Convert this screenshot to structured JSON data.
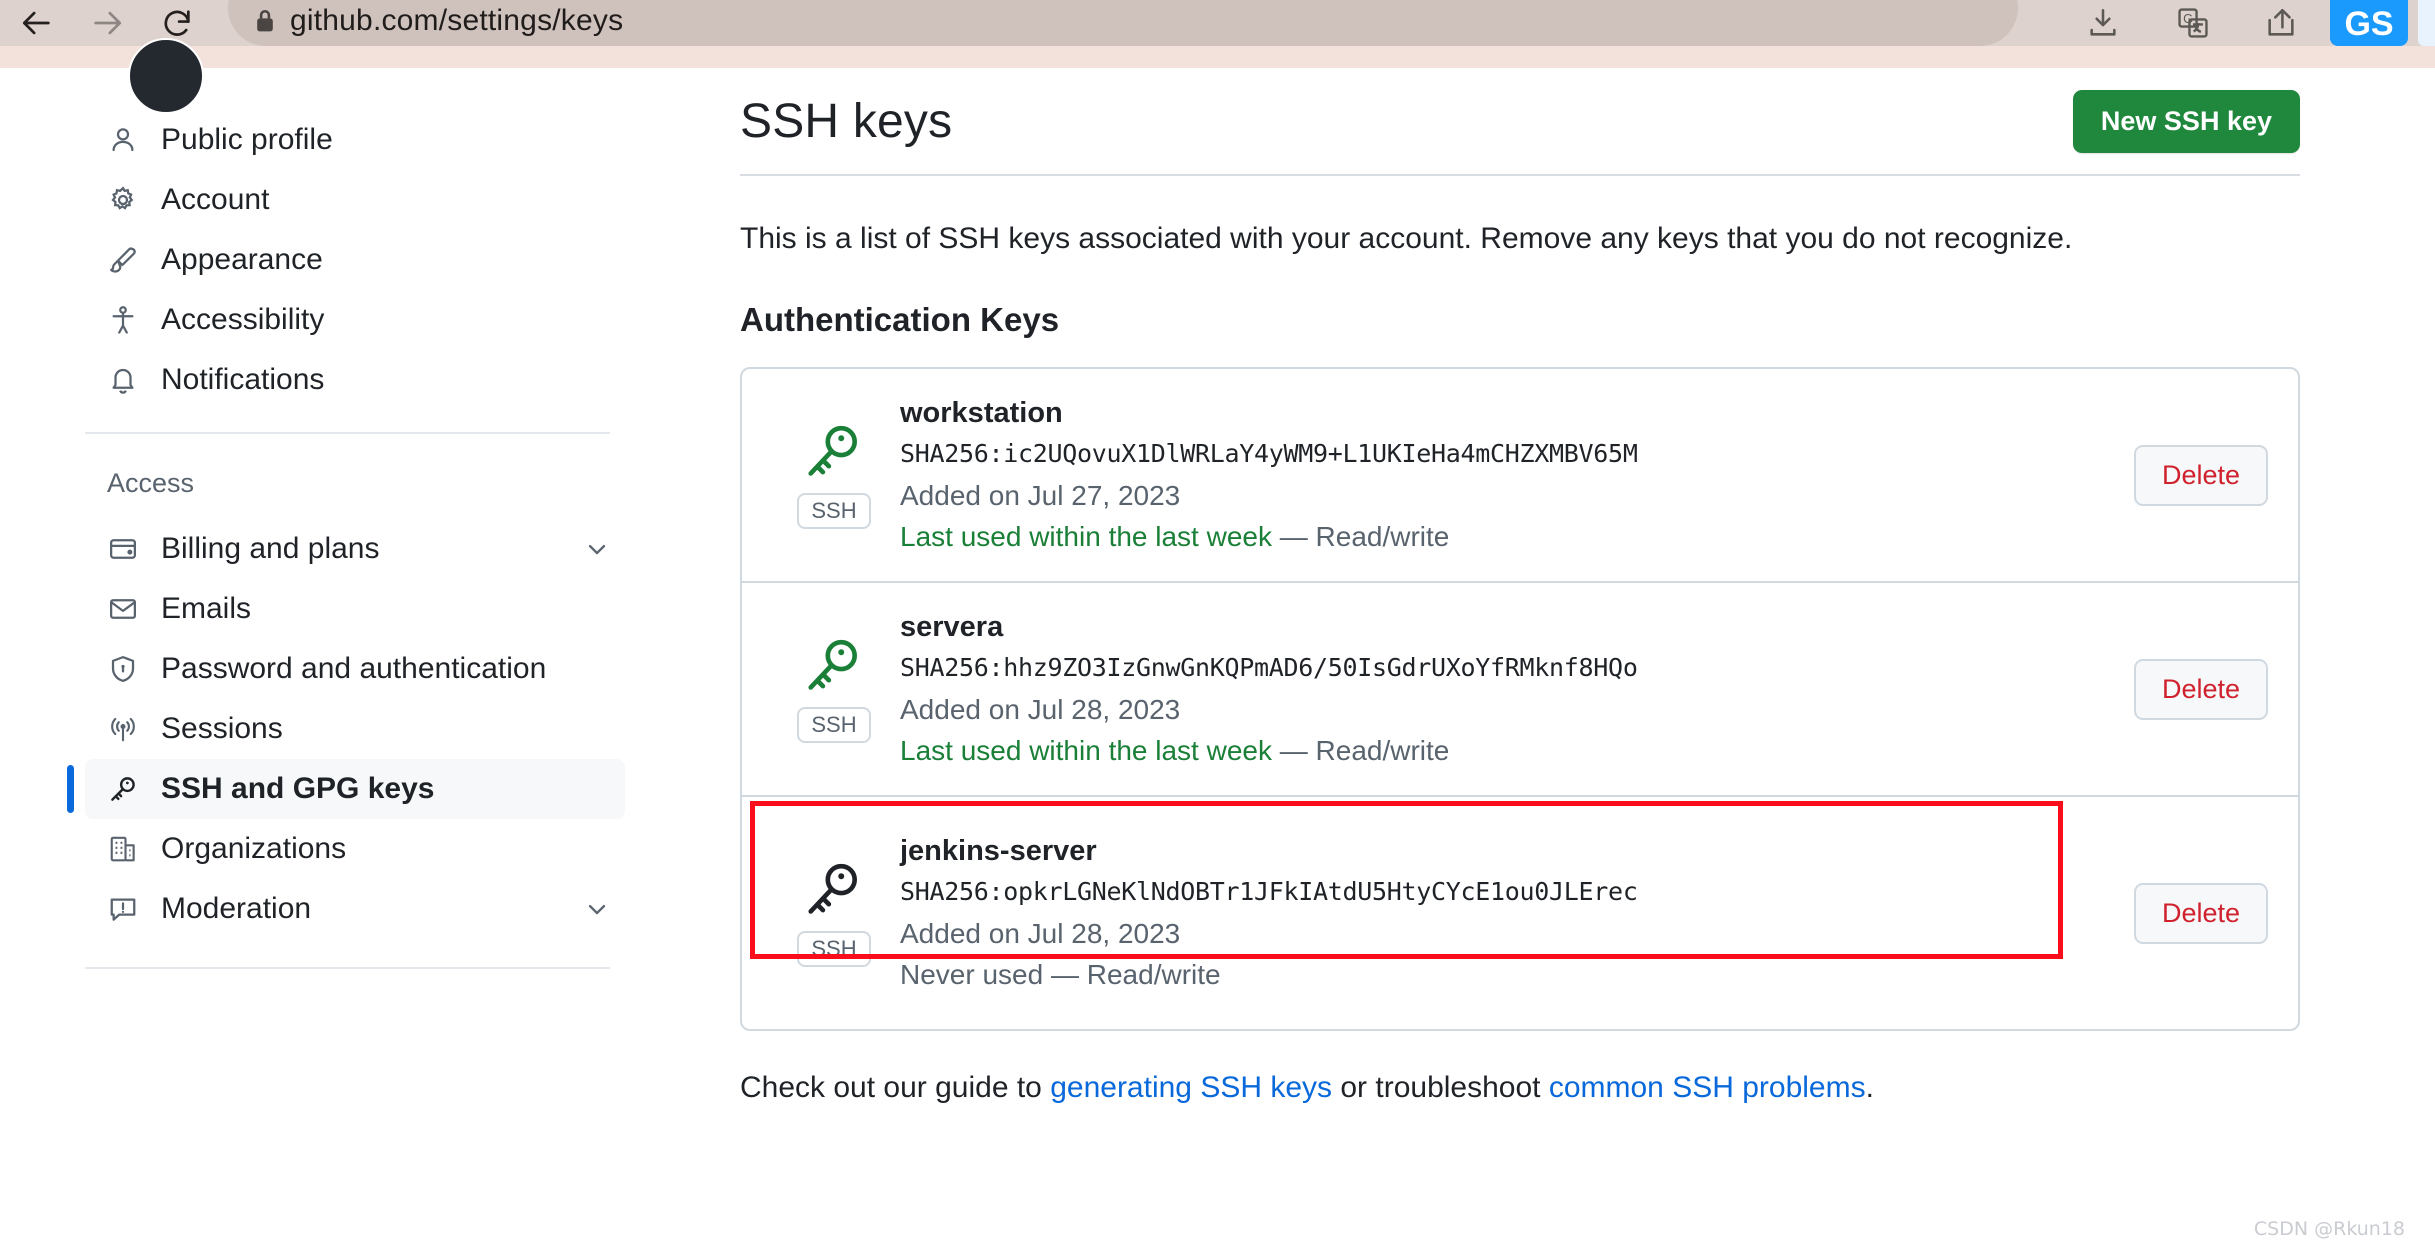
{
  "browser": {
    "url": "github.com/settings/keys",
    "back_icon": "arrow-left-icon",
    "forward_icon": "arrow-right-icon",
    "reload_icon": "reload-icon",
    "lock_icon": "lock-icon",
    "download_icon": "download-icon",
    "translate_icon": "translate-icon",
    "share_icon": "share-icon",
    "profile_initials": "GS",
    "colors": {
      "toolbar": "#ded2ce",
      "omnibox": "#cfc2bd",
      "strip": "#f3e2dc",
      "avatar": "#1a9afd"
    }
  },
  "sidebar": {
    "items_top": [
      {
        "label": "Public profile",
        "icon": "person-icon"
      },
      {
        "label": "Account",
        "icon": "gear-icon"
      },
      {
        "label": "Appearance",
        "icon": "paintbrush-icon"
      },
      {
        "label": "Accessibility",
        "icon": "accessibility-icon"
      },
      {
        "label": "Notifications",
        "icon": "bell-icon"
      }
    ],
    "access_heading": "Access",
    "items_access": [
      {
        "label": "Billing and plans",
        "icon": "credit-card-icon",
        "chevron": true,
        "selected": false
      },
      {
        "label": "Emails",
        "icon": "mail-icon",
        "chevron": false,
        "selected": false
      },
      {
        "label": "Password and authentication",
        "icon": "shield-lock-icon",
        "chevron": false,
        "selected": false
      },
      {
        "label": "Sessions",
        "icon": "broadcast-icon",
        "chevron": false,
        "selected": false
      },
      {
        "label": "SSH and GPG keys",
        "icon": "key-icon",
        "chevron": false,
        "selected": true
      },
      {
        "label": "Organizations",
        "icon": "organization-icon",
        "chevron": false,
        "selected": false
      },
      {
        "label": "Moderation",
        "icon": "report-icon",
        "chevron": true,
        "selected": false
      }
    ]
  },
  "main": {
    "title": "SSH keys",
    "new_key_button": "New SSH key",
    "intro": "This is a list of SSH keys associated with your account. Remove any keys that you do not recognize.",
    "section_heading": "Authentication Keys",
    "delete_label": "Delete",
    "keys": [
      {
        "name": "workstation",
        "fingerprint": "SHA256:ic2UQovuX1DlWRLaY4yWM9+L1UKIeHa4mCHZXMBV65M",
        "added": "Added on Jul 27, 2023",
        "usage": "Last used within the last week",
        "usage_state": "used",
        "permission": "Read/write",
        "badge": "SSH",
        "key_icon_color": "#1a7f37",
        "annotated": false
      },
      {
        "name": "servera",
        "fingerprint": "SHA256:hhz9ZO3IzGnwGnKQPmAD6/50IsGdrUXoYfRMknf8HQo",
        "added": "Added on Jul 28, 2023",
        "usage": "Last used within the last week",
        "usage_state": "used",
        "permission": "Read/write",
        "badge": "SSH",
        "key_icon_color": "#1a7f37",
        "annotated": false
      },
      {
        "name": "jenkins-server",
        "fingerprint": "SHA256:opkrLGNeKlNdOBTr1JFkIAtdU5HtyCYcE1ou0JLErec",
        "added": "Added on Jul 28, 2023",
        "usage": "Never used",
        "usage_state": "never",
        "permission": "Read/write",
        "badge": "SSH",
        "key_icon_color": "#1f2328",
        "annotated": true
      }
    ],
    "footer": {
      "part1": "Check out our guide to ",
      "link1": "generating SSH keys",
      "part2": " or troubleshoot ",
      "link2": "common SSH problems",
      "part3": "."
    }
  },
  "watermark": "CSDN @Rkun18",
  "annotation": {
    "color": "#fc0d1c"
  }
}
